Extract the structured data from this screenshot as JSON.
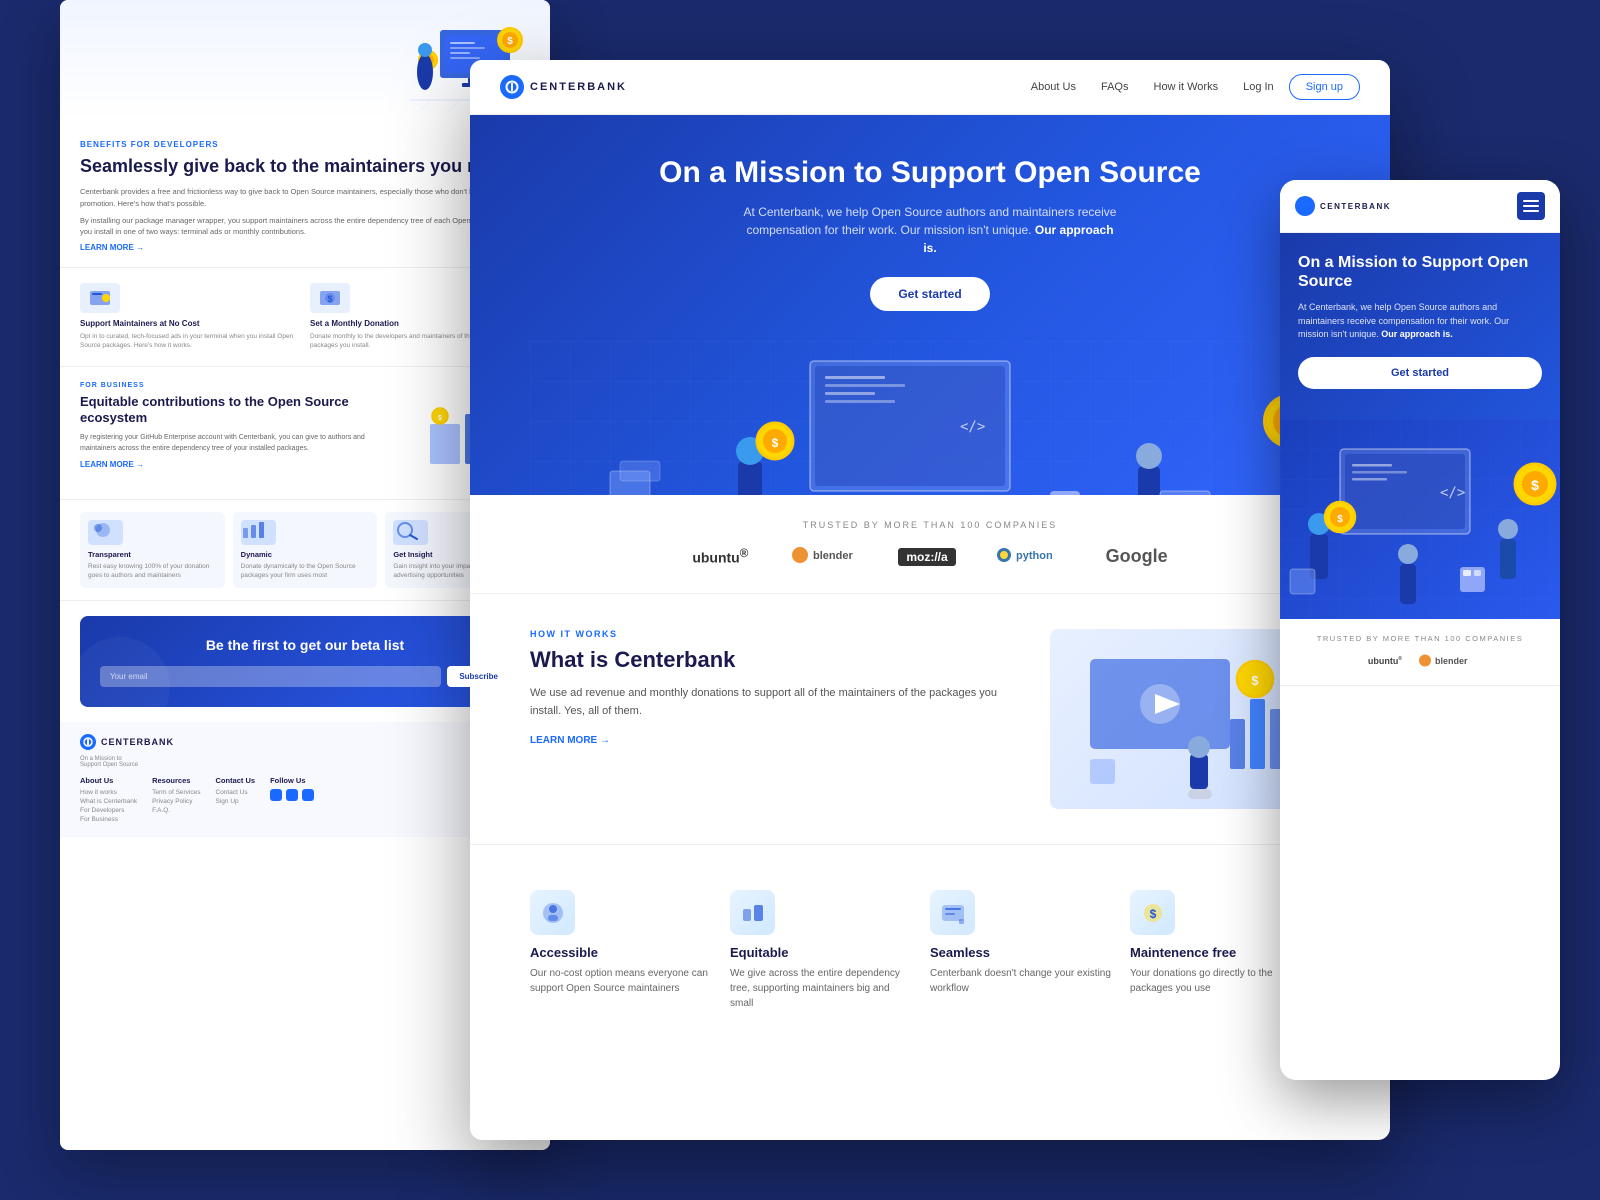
{
  "app": {
    "brand": "CENTERBANK",
    "logo_icon": "C"
  },
  "left_panel": {
    "hero": {
      "tag": "BENEFITS FOR DEVELOPERS",
      "title": "Seamlessly give back to the maintainers you rely on",
      "description": "Centerbank provides a free and frictionless way to give back to Open Source maintainers, especially those who don't have time for self-promotion. Here's how that's possible.",
      "description2": "By installing our package manager wrapper, you support maintainers across the entire dependency tree of each Open Source package you install in one of two ways: terminal ads or monthly contributions.",
      "learn_more": "LEARN MORE →"
    },
    "mini_cards": [
      {
        "title": "Support Maintainers at No Cost",
        "desc": "Opt in to curated, tech-focused ads in your terminal when you install Open Source packages. Here's how it works."
      },
      {
        "title": "Set a Monthly Donation",
        "desc": "Donate monthly to the developers and maintainers of the Open Source packages you install."
      }
    ],
    "business": {
      "tag": "FOR BUSINESS",
      "title": "Equitable contributions to the Open Source ecosystem",
      "desc": "By registering your GitHub Enterprise account with Centerbank, you can give to authors and maintainers across the entire dependency tree of your installed packages.",
      "learn_more": "LEARN MORE →"
    },
    "features": [
      {
        "title": "Transparent",
        "desc": "Rest easy knowing 100% of your donation goes to authors and maintainers"
      },
      {
        "title": "Dynamic",
        "desc": "Donate dynamically to the Open Source packages your firm uses most"
      },
      {
        "title": "Get Insight",
        "desc": "Gain insight into your impact and explore advertising opportunities"
      }
    ],
    "beta": {
      "title": "Be the first to get our beta list",
      "input_placeholder": "Your email",
      "button_label": "Subscribe"
    },
    "footer": {
      "brand": "CENTERBANK",
      "about_title": "About Us",
      "about_links": [
        "How it works",
        "What is Centerbank",
        "For Developers",
        "For Business"
      ],
      "resources_title": "Resources",
      "resources_links": [
        "Term of Services",
        "Privacy Policy",
        "F.A.Q."
      ],
      "contact_title": "Contact Us",
      "contact_links": [
        "Contact Us",
        "Sign Up"
      ],
      "follow_title": "Follow Us"
    }
  },
  "middle_panel": {
    "nav": {
      "brand": "CENTERBANK",
      "links": [
        "About Us",
        "FAQs",
        "How it Works"
      ],
      "login": "Log In",
      "signup": "Sign up"
    },
    "hero": {
      "title": "On a Mission to Support Open Source",
      "description": "At Centerbank, we help Open Source authors and maintainers receive compensation for their work. Our mission isn't unique.",
      "emphasis": "Our approach is.",
      "cta": "Get started"
    },
    "trusted": {
      "label": "TRUSTED BY MORE THAN 100 COMPANIES",
      "logos": [
        "ubuntu®",
        "blender",
        "moz://a",
        "python",
        "Google"
      ]
    },
    "how_it_works": {
      "tag": "HOW IT WORKS",
      "title": "What is Centerbank",
      "description": "We use ad revenue and monthly donations to support all of the maintainers of the packages you install. Yes, all of them.",
      "learn_more": "LEARN MORE →"
    },
    "features": [
      {
        "title": "Accessible",
        "desc": "Our no-cost option means everyone can support Open Source maintainers"
      },
      {
        "title": "Equitable",
        "desc": "We give across the entire dependency tree, supporting maintainers big and small"
      },
      {
        "title": "Seamless",
        "desc": "Centerbank doesn't change your existing workflow"
      },
      {
        "title": "Maintenence free",
        "desc": "Your donations go directly to the packages you use"
      }
    ]
  },
  "right_panel": {
    "nav": {
      "brand": "CENTERBANK"
    },
    "hero": {
      "title": "On a Mission to Support Open Source",
      "description": "At Centerbank, we help Open Source authors and maintainers receive compensation for their work. Our mission isn't unique.",
      "emphasis": "Our approach is.",
      "cta": "Get started"
    },
    "trusted": {
      "label": "TRUSTED BY MORE THAN 100 COMPANIES",
      "logos": [
        "ubuntu®",
        "blender"
      ]
    }
  },
  "colors": {
    "primary": "#1a6aff",
    "dark_blue": "#1a1a4e",
    "navy": "#1a3aaa",
    "bg": "#1a2a6c",
    "white": "#ffffff",
    "light_blue": "#e8f0ff",
    "gold": "#ffd700"
  }
}
